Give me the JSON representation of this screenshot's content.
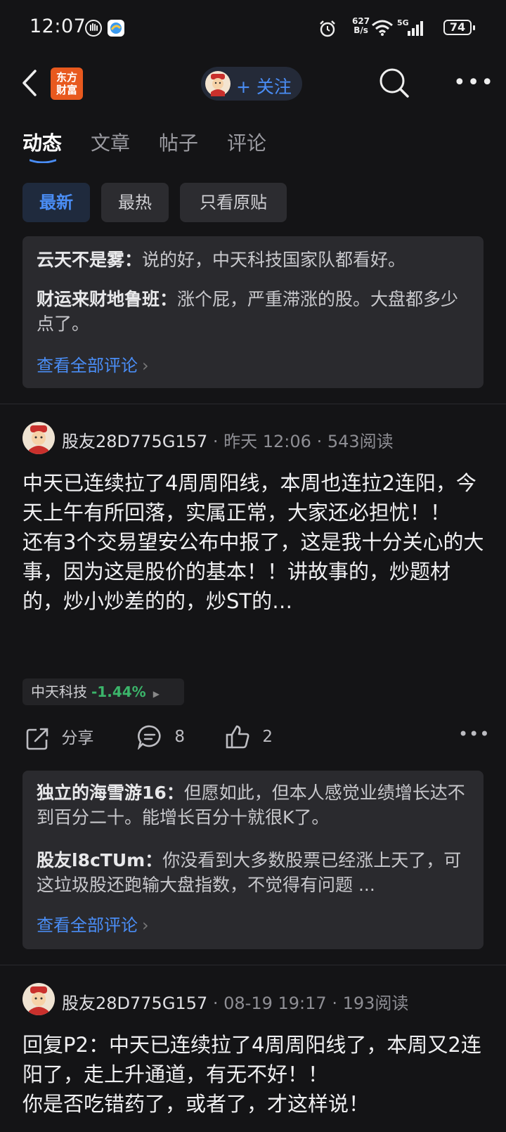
{
  "status_bar": {
    "time": "12:07",
    "speed_value": "627",
    "speed_unit": "B/s",
    "network": "5G",
    "battery": "74"
  },
  "header": {
    "back_icon": "chevron-left-icon",
    "logo_line1": "东方",
    "logo_line2": "财富",
    "follow_label": "+ 关注",
    "search_icon": "search-icon",
    "menu_icon": "more-icon"
  },
  "tabs": [
    {
      "label": "动态",
      "active": true
    },
    {
      "label": "文章",
      "active": false
    },
    {
      "label": "帖子",
      "active": false
    },
    {
      "label": "评论",
      "active": false
    }
  ],
  "filters": [
    {
      "label": "最新",
      "active": true
    },
    {
      "label": "最热",
      "active": false
    },
    {
      "label": "只看原贴",
      "active": false
    }
  ],
  "top_comments": {
    "items": [
      {
        "name": "云天不是雾：",
        "text": "说的好，中天科技国家队都看好。"
      },
      {
        "name": "财运来财地鲁班：",
        "text": "涨个屁，严重滞涨的股。大盘都多少点了。"
      }
    ],
    "view_all": "查看全部评论"
  },
  "post1": {
    "user": "股友28D775G157",
    "time": "昨天 12:06",
    "reads": "543阅读",
    "content": "中天已连续拉了4周周阳线，本周也连拉2连阳，今天上午有所回落，实属正常，大家还必担忧！！\n还有3个交易望安公布中报了，这是我十分关心的大事，因为这是股价的基本！！讲故事的，炒题材的，炒小炒差的的，炒ST的…",
    "stock_name": "中天科技",
    "stock_change": "-1.44%",
    "share_label": "分享",
    "comment_count": "8",
    "like_count": "2",
    "comments": [
      {
        "name": "独立的海雪游16：",
        "text": "但愿如此，但本人感觉业绩增长达不到百分二十。能增长百分十就很K了。"
      },
      {
        "name": "股友l8cTUm：",
        "text": "你没看到大多数股票已经涨上天了，可这垃圾股还跑输大盘指数，不觉得有问题 ..."
      }
    ],
    "view_all": "查看全部评论"
  },
  "post2": {
    "user": "股友28D775G157",
    "time": "08-19 19:17",
    "reads": "193阅读",
    "content": "回复P2：中天已连续拉了4周周阳线了，本周又2连阳了，走上升通道，有无不好！！\n你是否吃错药了，或者了，才这样说！"
  },
  "colors": {
    "accent": "#4a8df5",
    "down_green": "#3bb56a",
    "logo_orange": "#e8591e",
    "background": "#141416"
  }
}
